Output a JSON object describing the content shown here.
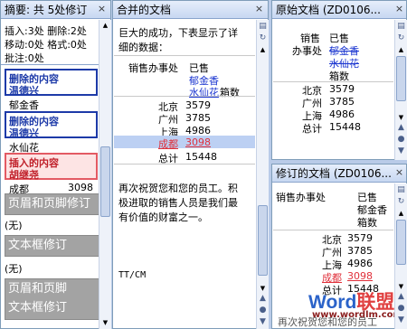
{
  "summary": {
    "title": "摘要: 共 5处修订",
    "line1": "插入:3处 删除:2处",
    "line2": "移动:0处 格式:0处",
    "line3": "批注:0处",
    "deleted": "删除的内容",
    "author1": "温德兴",
    "text1": "郁金香",
    "text2": "水仙花",
    "inserted": "插入的内容",
    "author2": "胡继尧",
    "row_city": "成都",
    "row_val": "3098",
    "header_footer": "页眉和页脚修订",
    "none1": "(无)",
    "textbox": "文本框修订",
    "none2": "(无)",
    "hf_tb_1": "页眉和页脚",
    "hf_tb_2": "文本框修订"
  },
  "merged": {
    "title": "合并的文档",
    "intro1": "巨大的成功，下表显示了详",
    "intro2": "细的数据：",
    "col1": "销售办事处",
    "col2": "已售",
    "f1": "郁金香",
    "f2": "水仙花",
    "unit": "箱数",
    "rows": [
      {
        "c": "北京",
        "v": "3579"
      },
      {
        "c": "广州",
        "v": "3785"
      },
      {
        "c": "上海",
        "v": "4986"
      },
      {
        "c": "成都",
        "v": "3098"
      },
      {
        "c": "总计",
        "v": "15448"
      }
    ],
    "p1": "再次祝贺您和您的员工。积",
    "p2": "极进取的销售人员是我们最",
    "p3": "有价值的财富之一。",
    "sig": "TT/CM"
  },
  "original": {
    "title": "原始文档 (ZD0106...",
    "col1": "销售",
    "col2": "已售",
    "col1b": "办事处",
    "f1": "郁金香",
    "f2": "水仙花",
    "unit": "箱数",
    "rows": [
      {
        "c": "北京",
        "v": "3579"
      },
      {
        "c": "广州",
        "v": "3785"
      },
      {
        "c": "上海",
        "v": "4986"
      },
      {
        "c": "总计",
        "v": "15448"
      }
    ]
  },
  "revised": {
    "title": "修订的文档 (ZD0106...",
    "col1": "销售办事处",
    "col2": "已售",
    "f1": "郁金香",
    "unit": "箱数",
    "rows": [
      {
        "c": "北京",
        "v": "3579"
      },
      {
        "c": "广州",
        "v": "3785"
      },
      {
        "c": "上海",
        "v": "4986"
      },
      {
        "c": "成都",
        "v": "3098"
      },
      {
        "c": "总计",
        "v": "15448"
      }
    ],
    "tail": "再次祝贺您和您的员工"
  },
  "watermark": {
    "brand1": "Word",
    "brand2": "联盟",
    "url": "www.wordlm.com"
  },
  "close": "×"
}
